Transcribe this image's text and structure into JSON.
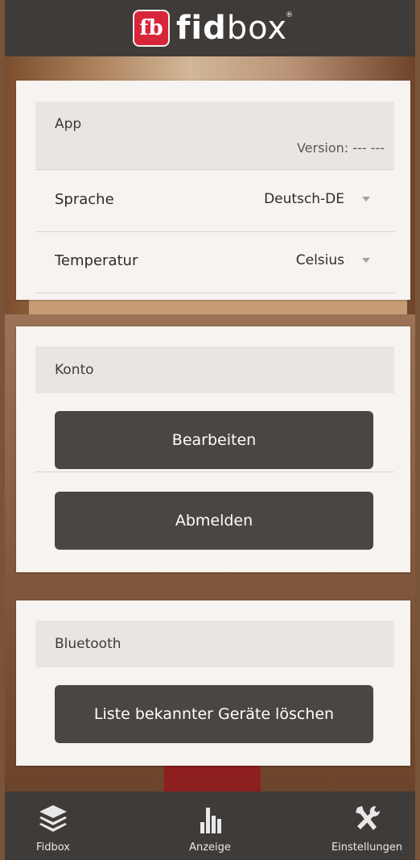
{
  "header": {
    "brand_mark": "fb",
    "brand_bold": "fid",
    "brand_light": "box",
    "registered": "®"
  },
  "app_section": {
    "title": "App",
    "version": "Version: --- ---",
    "settings": [
      {
        "label": "Sprache",
        "value": "Deutsch-DE"
      },
      {
        "label": "Temperatur",
        "value": "Celsius"
      }
    ]
  },
  "account_section": {
    "title": "Konto",
    "edit_button": "Bearbeiten",
    "logout_button": "Abmelden"
  },
  "bluetooth_section": {
    "title": "Bluetooth",
    "clear_button": "Liste bekannter Geräte löschen"
  },
  "nav": {
    "items": [
      {
        "label": "Fidbox",
        "icon": "layers-icon"
      },
      {
        "label": "Anzeige",
        "icon": "bar-chart-icon"
      },
      {
        "label": "Einstellungen",
        "icon": "tools-icon"
      }
    ]
  },
  "colors": {
    "header_bg": "#3f3b39",
    "button_bg": "#4b4643",
    "logo_red": "#d7263a",
    "card_bg": "#f6f3f1"
  }
}
